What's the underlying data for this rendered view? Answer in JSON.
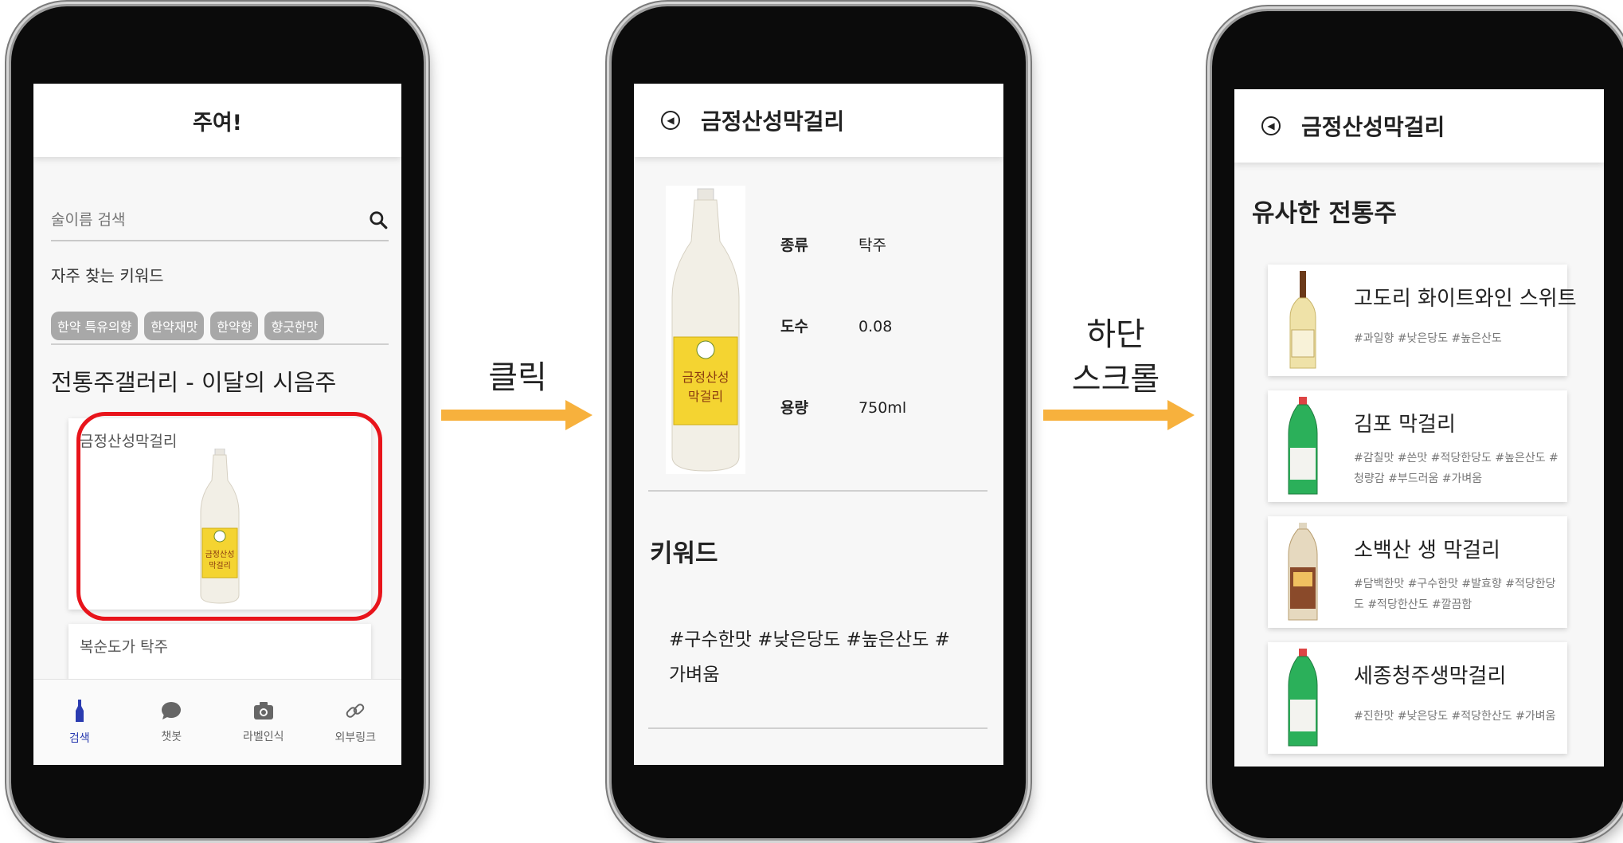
{
  "phone1": {
    "app_title": "주여!",
    "search": {
      "placeholder": "술이름 검색"
    },
    "keywords_title": "자주 찾는 키워드",
    "keyword_chips": [
      "한약 특유의향",
      "한약재맛",
      "한약향",
      "향긋한맛"
    ],
    "gallery_title": "전통주갤러리 - 이달의 시음주",
    "cards": [
      "금정산성막걸리",
      "복순도가 탁주"
    ],
    "nav": [
      {
        "label": "검색",
        "icon": "bottle-icon",
        "active": true
      },
      {
        "label": "챗봇",
        "icon": "chat-bubble-icon",
        "active": false
      },
      {
        "label": "라벨인식",
        "icon": "camera-icon",
        "active": false
      },
      {
        "label": "외부링크",
        "icon": "link-icon",
        "active": false
      }
    ]
  },
  "arrow1_label": "클릭",
  "phone2": {
    "title": "금정산성막걸리",
    "specs": [
      {
        "key": "종류",
        "value": "탁주"
      },
      {
        "key": "도수",
        "value": "0.08"
      },
      {
        "key": "용량",
        "value": "750ml"
      }
    ],
    "keyword_heading": "키워드",
    "keywords": "#구수한맛 #낮은당도 #높은산도 #가벼움"
  },
  "arrow2_label_line1": "하단",
  "arrow2_label_line2": "스크롤",
  "phone3": {
    "title": "금정산성막걸리",
    "similar_title": "유사한 전통주",
    "items": [
      {
        "name": "고도리 화이트와인 스위트",
        "tags": "#과일향 #낮은당도 #높은산도"
      },
      {
        "name": "김포 막걸리",
        "tags": "#감칠맛 #쓴맛 #적당한당도 #높은산도 #청량감 #부드러움 #가벼움"
      },
      {
        "name": "소백산 생 막걸리",
        "tags": "#담백한맛 #구수한맛 #발효향 #적당한당도 #적당한산도 #깔끔함"
      },
      {
        "name": "세종청주생막걸리",
        "tags": "#진한맛 #낮은당도 #적당한산도 #가벼움"
      }
    ]
  },
  "colors": {
    "highlight": "#e8141b",
    "arrow": "#f7b13d",
    "nav_active": "#2a3bb0",
    "chip": "#a8a8a8"
  }
}
